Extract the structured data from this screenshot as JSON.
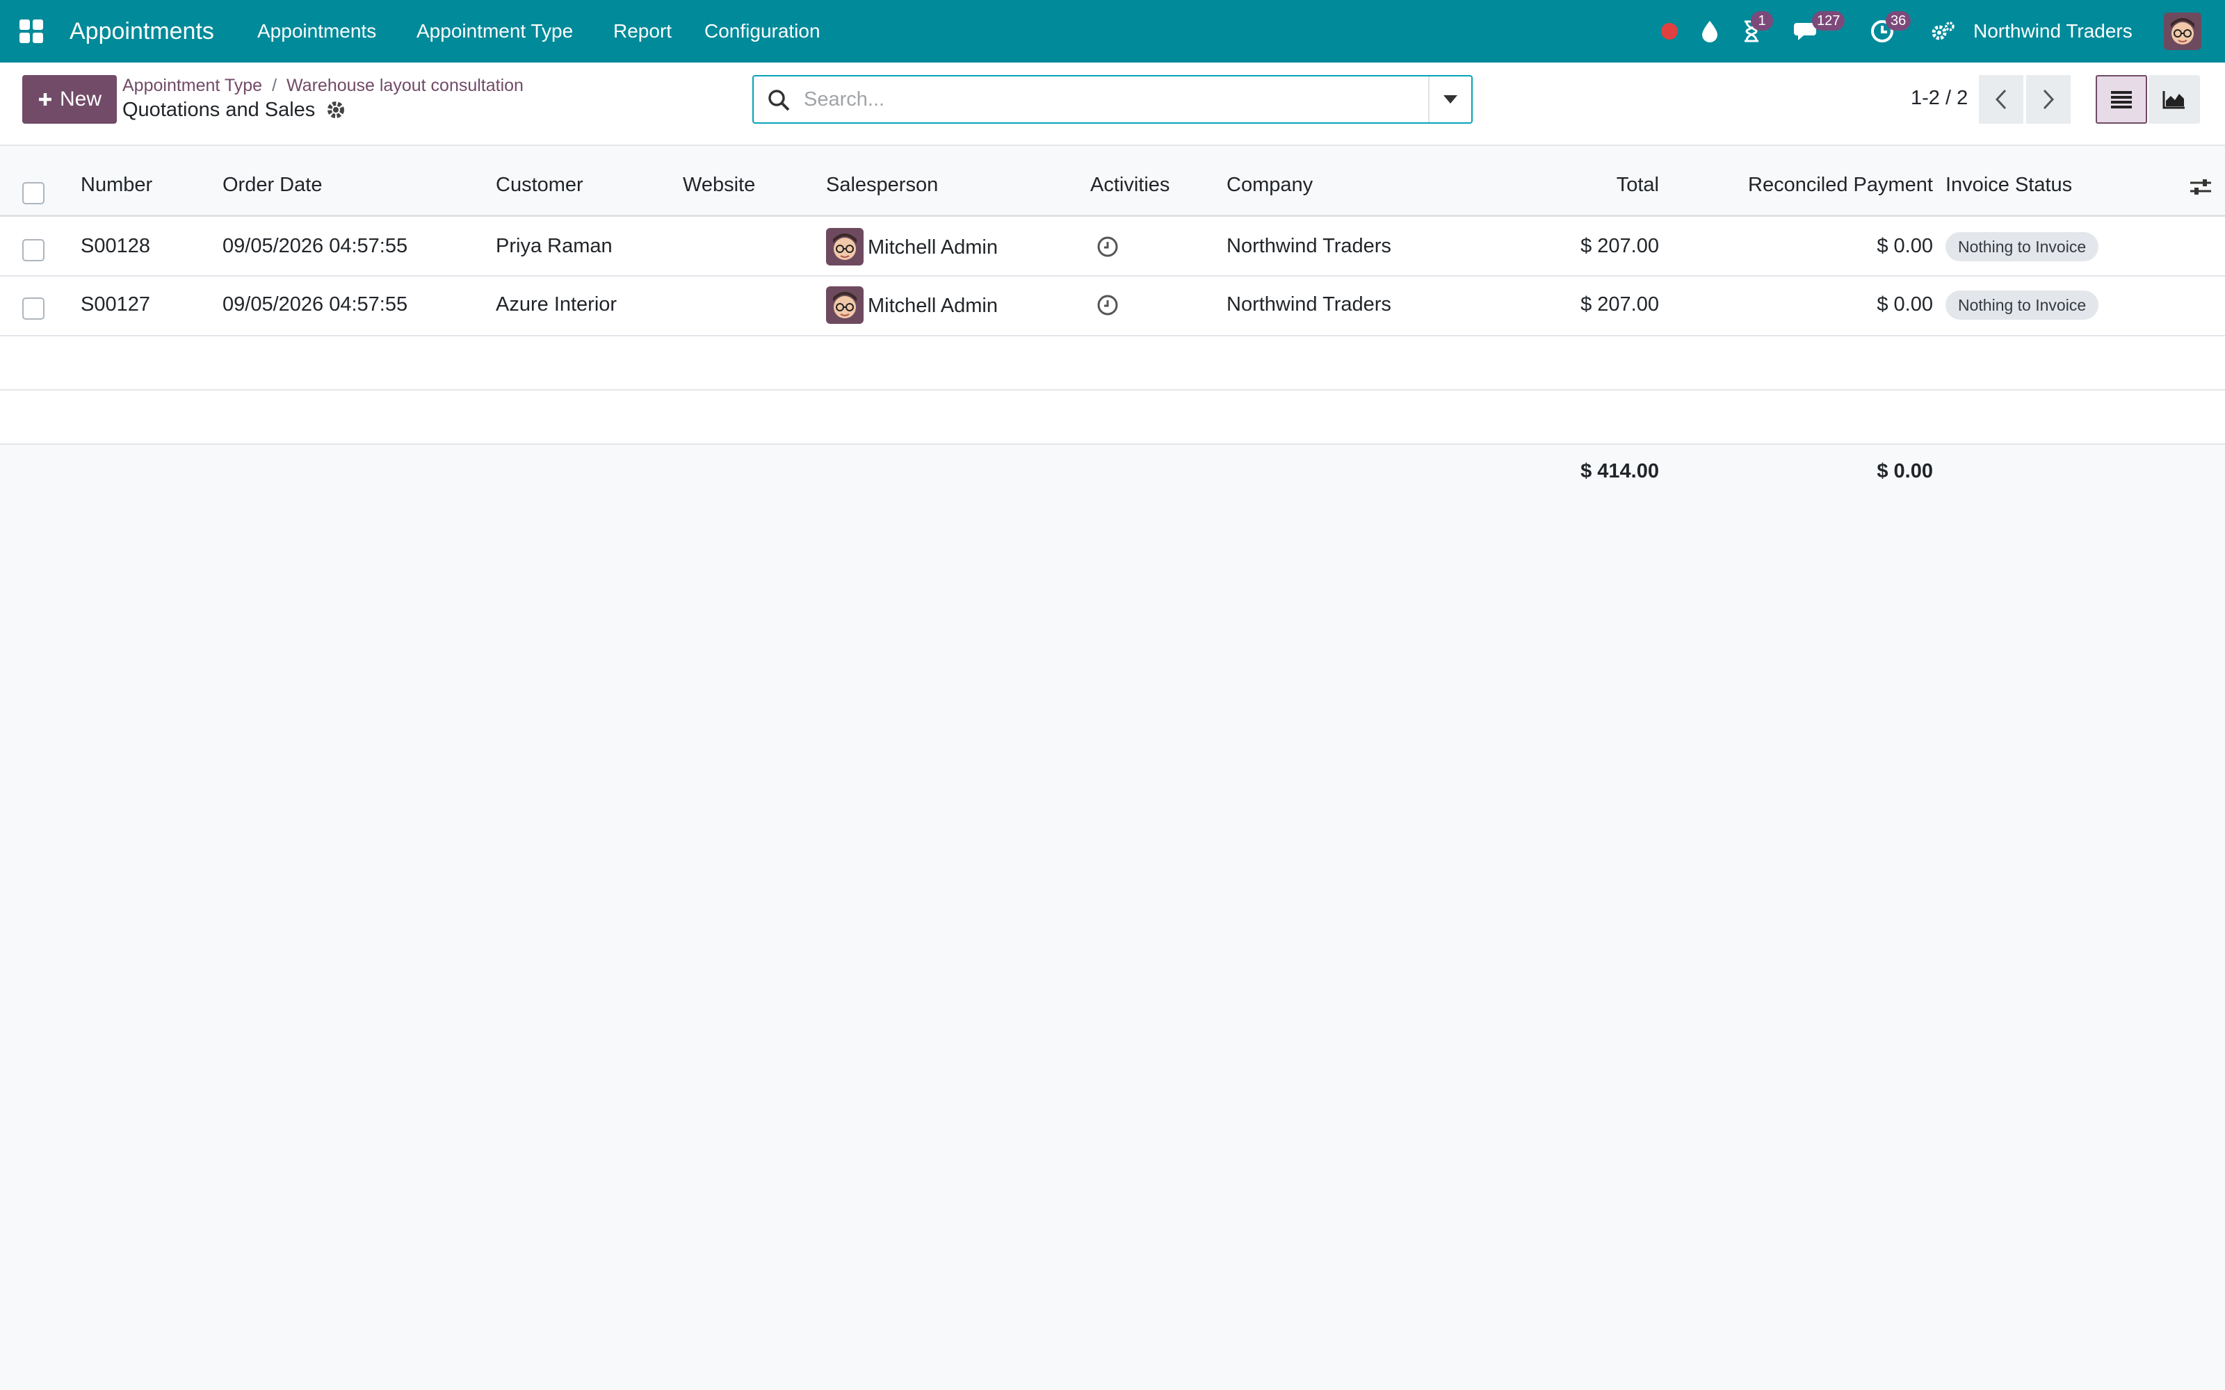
{
  "app": {
    "title": "Appointments",
    "menu": [
      "Appointments",
      "Appointment Type",
      "Report",
      "Configuration"
    ],
    "company": "Northwind Traders",
    "badges": {
      "activities": "1",
      "messages": "127",
      "timer": "36"
    },
    "colors": {
      "navbar": "#018a9a",
      "primary": "#714b67",
      "status_dot": "#e04040"
    }
  },
  "control_panel": {
    "new_label": "New",
    "breadcrumbs": [
      "Appointment Type",
      "Warehouse layout consultation"
    ],
    "breadcrumb_separator": "/",
    "title": "Quotations and Sales",
    "search": {
      "placeholder": "Search...",
      "value": ""
    },
    "pager": "1-2 / 2"
  },
  "table": {
    "columns": [
      "Number",
      "Order Date",
      "Customer",
      "Website",
      "Salesperson",
      "Activities",
      "Company",
      "Total",
      "Reconciled Payment",
      "Invoice Status"
    ],
    "rows": [
      {
        "number": "S00128",
        "order_date": "09/05/2026 04:57:55",
        "customer": "Priya Raman",
        "website": "",
        "salesperson": "Mitchell Admin",
        "company": "Northwind Traders",
        "total": "$ 207.00",
        "reconciled": "$ 0.00",
        "status": "Nothing to Invoice"
      },
      {
        "number": "S00127",
        "order_date": "09/05/2026 04:57:55",
        "customer": "Azure Interior",
        "website": "",
        "salesperson": "Mitchell Admin",
        "company": "Northwind Traders",
        "total": "$ 207.00",
        "reconciled": "$ 0.00",
        "status": "Nothing to Invoice"
      }
    ],
    "totals": {
      "total": "$ 414.00",
      "reconciled": "$ 0.00"
    }
  }
}
